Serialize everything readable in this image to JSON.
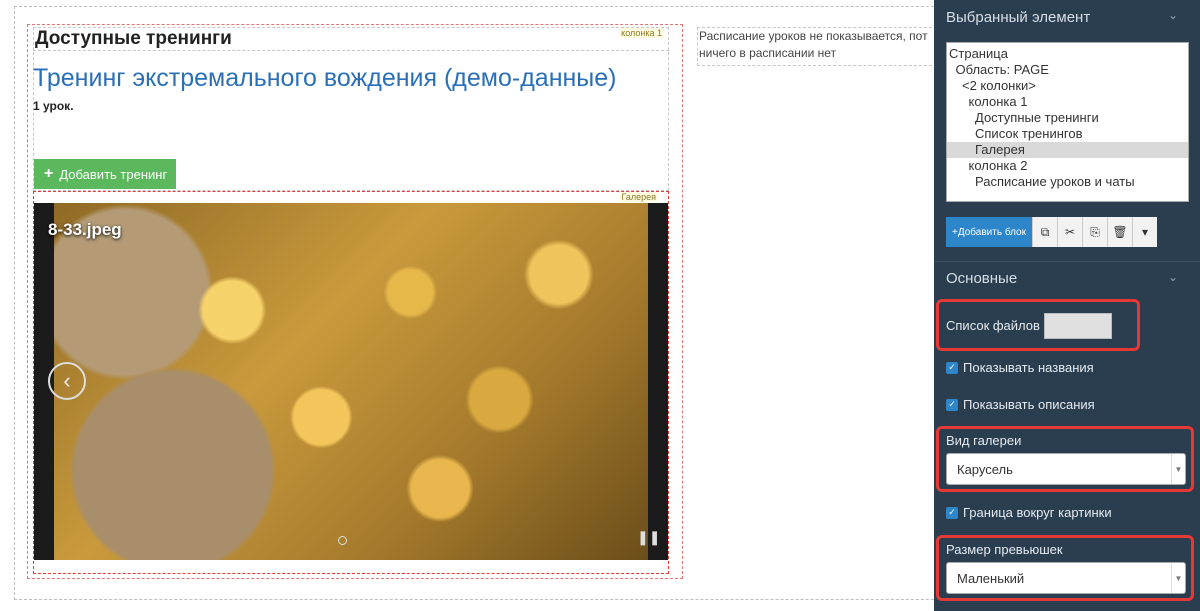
{
  "canvas": {
    "column_badge": "колонка 1",
    "available_heading": "Доступные тренинги",
    "training_title": "Тренинг экстремального вождения (демо-данные)",
    "lessons_count": "1 урок.",
    "add_training_label": "Добавить тренинг",
    "gallery_badge": "Галерея",
    "gallery": {
      "image_title": "8-33.jpeg",
      "prev_arrow": "‹",
      "pause": "❚❚"
    },
    "column2_text_line1": "Расписание уроков не показывается, пот",
    "column2_text_line2": "ничего в расписании нет"
  },
  "panel": {
    "selected_title": "Выбранный элемент",
    "tree": [
      {
        "label": "Страница",
        "indent": 0,
        "selected": false
      },
      {
        "label": "Область: PAGE",
        "indent": 1,
        "selected": false
      },
      {
        "label": "<2 колонки>",
        "indent": 2,
        "selected": false
      },
      {
        "label": "колонка 1",
        "indent": 3,
        "selected": false
      },
      {
        "label": "Доступные тренинги",
        "indent": 4,
        "selected": false
      },
      {
        "label": "Список тренингов",
        "indent": 4,
        "selected": false
      },
      {
        "label": "Галерея",
        "indent": 4,
        "selected": true
      },
      {
        "label": "колонка 2",
        "indent": 3,
        "selected": false
      },
      {
        "label": "Расписание уроков и чаты",
        "indent": 4,
        "selected": false
      }
    ],
    "add_block_label": "+Добавить блок",
    "basic_title": "Основные",
    "files_label": "Список файлов",
    "show_names_label": "Показывать названия",
    "show_descriptions_label": "Показывать описания",
    "gallery_view_label": "Вид галереи",
    "gallery_view_value": "Карусель",
    "border_label": "Граница вокруг картинки",
    "thumb_size_label": "Размер превьюшек",
    "thumb_size_value": "Маленький"
  },
  "colors": {
    "accent_green": "#5cb85c",
    "link_blue": "#2a6fb8",
    "panel_bg": "#2b3e50",
    "highlight_red": "#e53935"
  }
}
